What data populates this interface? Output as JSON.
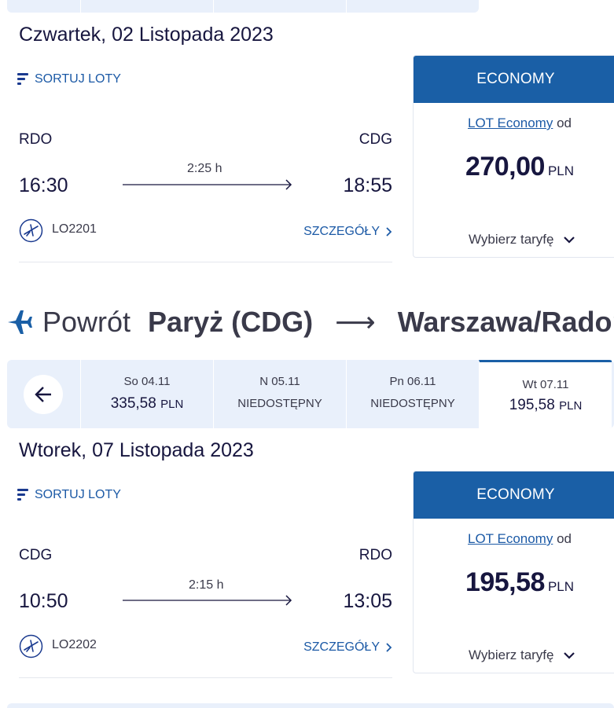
{
  "outbound": {
    "date_heading": "Czwartek, 02 Listopada 2023",
    "sort_label": "SORTUJ LOTY",
    "flight": {
      "from": "RDO",
      "to": "CDG",
      "depart": "16:30",
      "arrive": "18:55",
      "duration": "2:25 h",
      "flight_number": "LO2201",
      "details_label": "SZCZEGÓŁY"
    },
    "fare": {
      "header": "ECONOMY",
      "fare_link": "LOT Economy",
      "from_word": "od",
      "price": "270,00",
      "currency": "PLN",
      "choose_label": "Wybierz taryfę"
    }
  },
  "return": {
    "icon": "airplane-icon",
    "label": "Powrót",
    "origin": "Paryż (CDG)",
    "arrow": "⟶",
    "destination": "Warszawa/Radom",
    "days": [
      {
        "label": "So 04.11",
        "price": "335,58",
        "currency": "PLN",
        "available": true
      },
      {
        "label": "N 05.11",
        "status": "NIEDOSTĘPNY",
        "available": false
      },
      {
        "label": "Pn 06.11",
        "status": "NIEDOSTĘPNY",
        "available": false
      },
      {
        "label": "Wt 07.11",
        "price": "195,58",
        "currency": "PLN",
        "available": true,
        "selected": true
      }
    ],
    "date_heading": "Wtorek, 07 Listopada 2023",
    "sort_label": "SORTUJ LOTY",
    "flight": {
      "from": "CDG",
      "to": "RDO",
      "depart": "10:50",
      "arrive": "13:05",
      "duration": "2:15 h",
      "flight_number": "LO2202",
      "details_label": "SZCZEGÓŁY"
    },
    "fare": {
      "header": "ECONOMY",
      "fare_link": "LOT Economy",
      "from_word": "od",
      "price": "195,58",
      "currency": "PLN",
      "choose_label": "Wybierz taryfę"
    }
  },
  "colors": {
    "brand_blue": "#1a5fa6",
    "link_blue": "#1c5aa6",
    "navy_text": "#17163f",
    "strip_bg": "#e9f0fb"
  }
}
